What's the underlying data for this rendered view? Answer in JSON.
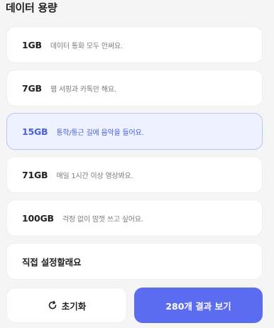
{
  "section": {
    "title": "데이터 용량"
  },
  "options": [
    {
      "size": "1GB",
      "desc": "데이터 통화 모두 안써요."
    },
    {
      "size": "7GB",
      "desc": "웹 서핑과 카톡만 해요."
    },
    {
      "size": "15GB",
      "desc": "통학/통근 길에 음악을 들어요."
    },
    {
      "size": "71GB",
      "desc": "매일 1시간 이상 영상봐요."
    },
    {
      "size": "100GB",
      "desc": "걱정 없이 맘껏 쓰고 싶어요."
    },
    {
      "size": "직접 설정할래요",
      "desc": ""
    }
  ],
  "selected_index": 2,
  "footer": {
    "reset_label": "초기화",
    "reset_icon": "refresh-icon",
    "result_label": "280개 결과 보기"
  },
  "colors": {
    "accent": "#5b6cf0",
    "selected_bg": "#eef2ff",
    "selected_text": "#4a5fe0"
  }
}
